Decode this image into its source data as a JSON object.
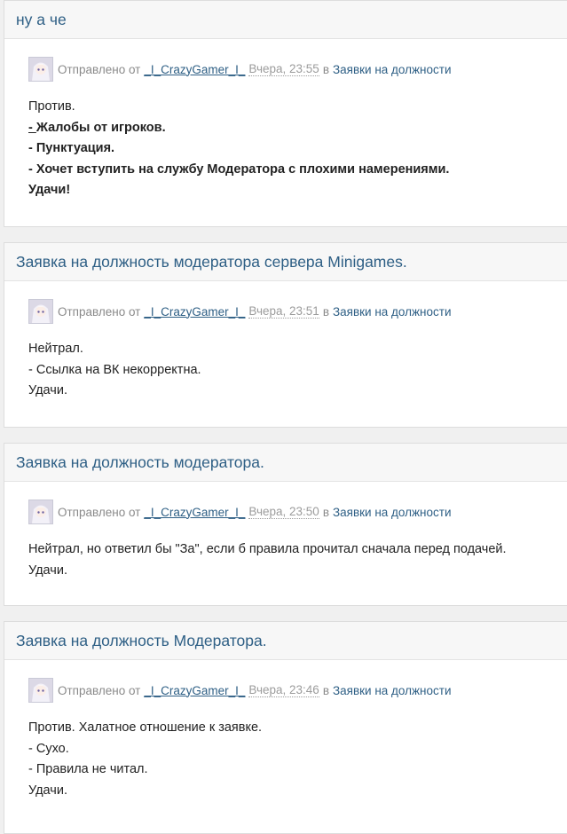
{
  "common": {
    "sent_by": "Отправлено от",
    "author": "_I_CrazyGamer_I_",
    "in_word": "в",
    "forum": "Заявки на должности"
  },
  "posts": [
    {
      "title": "ну а че",
      "time": "Вчера, 23:55",
      "lines": [
        "Против.",
        "- Жалобы от игроков.",
        "- Пунктуация.",
        "- Хочет вступить на службу Модератора с плохими намерениями.",
        "Удачи!"
      ]
    },
    {
      "title": "Заявка на должность модератора сервера Minigames.",
      "time": "Вчера, 23:51",
      "lines": [
        "Нейтрал.",
        "- Ссылка на ВК некорректна.",
        "Удачи."
      ]
    },
    {
      "title": "Заявка на должность модератора.",
      "time": "Вчера, 23:50",
      "lines": [
        "Нейтрал, но ответил бы \"За\", если б правила прочитал сначала перед подачей.",
        "Удачи."
      ]
    },
    {
      "title": "Заявка на должность Модератора.",
      "time": "Вчера, 23:46",
      "lines": [
        "Против. Халатное отношение к заявке.",
        "- Сухо.",
        "- Правила не читал.",
        "Удачи."
      ]
    }
  ]
}
